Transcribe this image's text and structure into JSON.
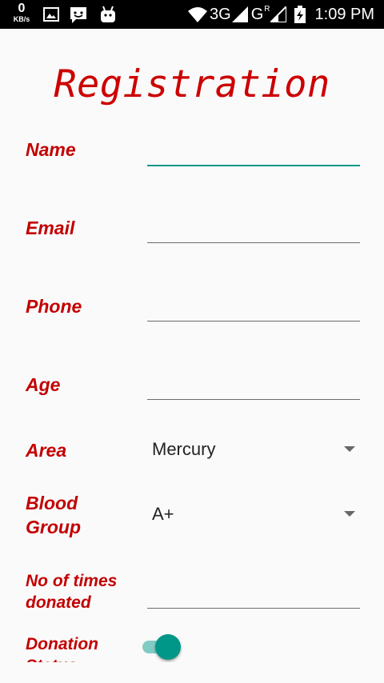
{
  "status_bar": {
    "speed_value": "0",
    "speed_unit": "KB/s",
    "net_3g": "3G",
    "net_g": "G",
    "net_r": "R",
    "time": "1:09 PM"
  },
  "title": "Registration",
  "form": {
    "name_label": "Name",
    "name_value": "",
    "email_label": "Email",
    "email_value": "",
    "phone_label": "Phone",
    "phone_value": "",
    "age_label": "Age",
    "age_value": "",
    "area_label": "Area",
    "area_value": "Mercury",
    "blood_label_1": "Blood",
    "blood_label_2": "Group",
    "blood_value": "A+",
    "donated_label_1": "No of times",
    "donated_label_2": "donated",
    "donated_value": "",
    "status_label_1": "Donation",
    "status_label_2": "Status",
    "status_on": true
  },
  "colors": {
    "label": "#c30000",
    "title": "#cc0000",
    "accent": "#009688"
  }
}
